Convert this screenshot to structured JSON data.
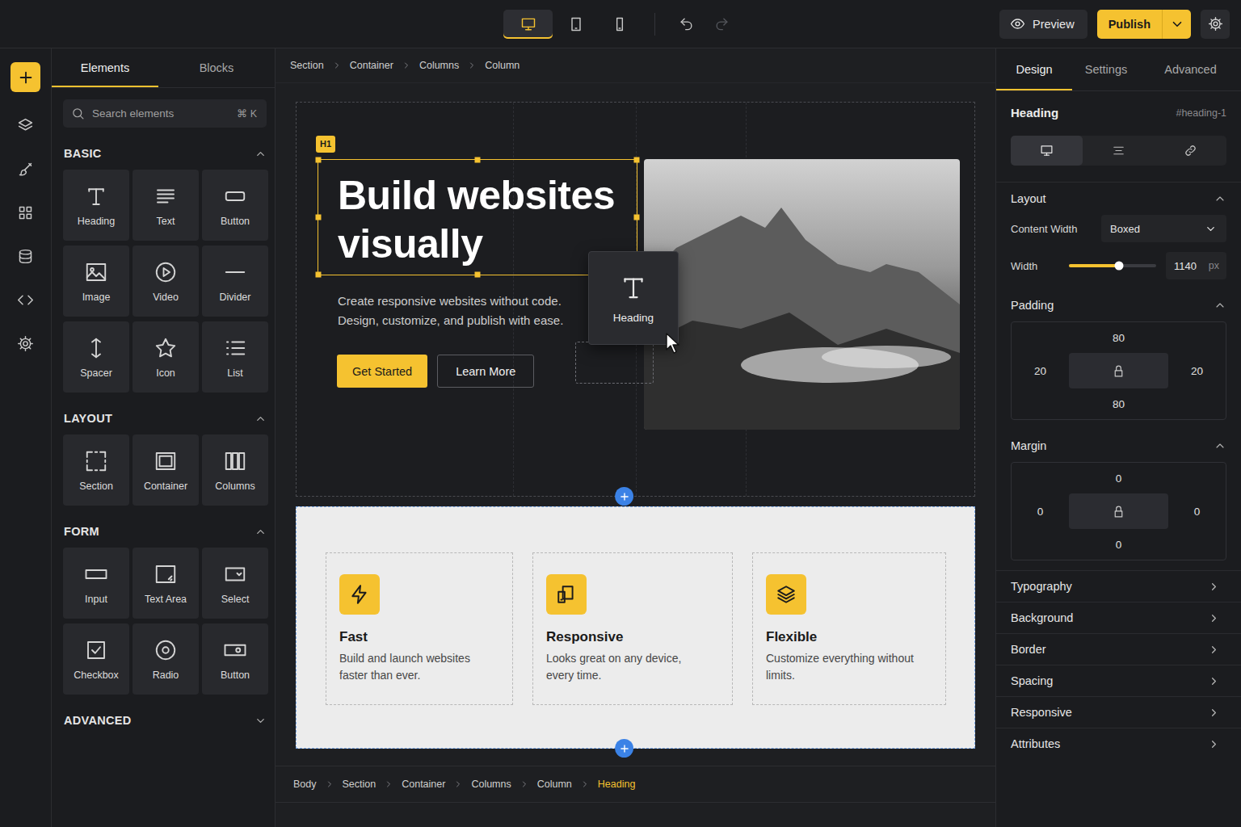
{
  "topbar": {
    "devices": [
      {
        "kind": "desktop",
        "selected": true
      },
      {
        "kind": "tablet",
        "selected": false
      },
      {
        "kind": "mobile",
        "selected": false
      }
    ],
    "history": [
      {
        "kind": "undo",
        "disabled": false
      },
      {
        "kind": "redo",
        "disabled": true
      }
    ],
    "preview": "Preview",
    "publish": "Publish"
  },
  "rail": [
    {
      "kind": "plus",
      "selected": true
    },
    {
      "kind": "layers",
      "selected": false
    },
    {
      "kind": "brush",
      "selected": false
    },
    {
      "kind": "grid",
      "selected": false
    },
    {
      "kind": "database",
      "selected": false
    },
    {
      "kind": "code",
      "selected": false
    },
    {
      "kind": "gear",
      "selected": false
    }
  ],
  "library": {
    "tabs": [
      {
        "label": "Elements",
        "selected": true
      },
      {
        "label": "Blocks",
        "selected": false
      }
    ],
    "search": {
      "placeholder": "Search elements",
      "shortcut": "⌘ K"
    },
    "groups": [
      {
        "title": "BASIC",
        "expanded": true,
        "items": [
          {
            "label": "Heading",
            "kind": "heading"
          },
          {
            "label": "Text",
            "kind": "text"
          },
          {
            "label": "Button",
            "kind": "button"
          },
          {
            "label": "Image",
            "kind": "image"
          },
          {
            "label": "Video",
            "kind": "video"
          },
          {
            "label": "Divider",
            "kind": "divider"
          },
          {
            "label": "Spacer",
            "kind": "spacer"
          },
          {
            "label": "Icon",
            "kind": "star"
          },
          {
            "label": "List",
            "kind": "list"
          }
        ]
      },
      {
        "title": "LAYOUT",
        "expanded": true,
        "items": [
          {
            "label": "Section",
            "kind": "section"
          },
          {
            "label": "Container",
            "kind": "container"
          },
          {
            "label": "Columns",
            "kind": "columns"
          }
        ]
      },
      {
        "title": "FORM",
        "expanded": true,
        "items": [
          {
            "label": "Input",
            "kind": "input"
          },
          {
            "label": "Text Area",
            "kind": "textarea"
          },
          {
            "label": "Select",
            "kind": "select"
          },
          {
            "label": "Checkbox",
            "kind": "checkbox"
          },
          {
            "label": "Radio",
            "kind": "radio"
          },
          {
            "label": "Button",
            "kind": "toggle"
          }
        ]
      },
      {
        "title": "ADVANCED",
        "expanded": false,
        "items": []
      }
    ]
  },
  "canvas": {
    "breadcrumb": [
      "Section",
      "Container",
      "Columns",
      "Column"
    ],
    "hero": {
      "badge": "H1",
      "heading": "Build websites visually",
      "lead": "Create responsive websites without code. Design, customize, and publish with ease.",
      "buttons": [
        {
          "label": "Get Started",
          "kind": "primary"
        },
        {
          "label": "Learn More",
          "kind": "secondary"
        }
      ]
    },
    "drag": {
      "label": "Heading",
      "kind": "heading"
    },
    "features": [
      {
        "title": "Fast",
        "text": "Build and launch websites faster than ever.",
        "kind": "bolt"
      },
      {
        "title": "Responsive",
        "text": "Looks great on any device, every time.",
        "kind": "devices"
      },
      {
        "title": "Flexible",
        "text": "Customize everything without limits.",
        "kind": "stack"
      }
    ]
  },
  "path": [
    {
      "label": "Body",
      "selected": false
    },
    {
      "label": "Section",
      "selected": false
    },
    {
      "label": "Container",
      "selected": false
    },
    {
      "label": "Columns",
      "selected": false
    },
    {
      "label": "Column",
      "selected": false
    },
    {
      "label": "Heading",
      "selected": true
    }
  ],
  "inspector": {
    "tabs": [
      {
        "label": "Design",
        "selected": true
      },
      {
        "label": "Settings",
        "selected": false
      },
      {
        "label": "Advanced",
        "selected": false
      }
    ],
    "element": {
      "title": "Heading",
      "id": "#heading-1"
    },
    "modes": [
      {
        "kind": "desktop",
        "selected": true
      },
      {
        "kind": "align",
        "selected": false
      },
      {
        "kind": "link",
        "selected": false
      }
    ],
    "layout": {
      "title": "Layout",
      "expanded": true,
      "content_width": {
        "label": "Content Width",
        "value": "Boxed"
      },
      "width": {
        "label": "Width",
        "level": 0.57,
        "value": "1140",
        "unit": "px"
      }
    },
    "padding": {
      "title": "Padding",
      "expanded": true,
      "locked": true,
      "top": "80",
      "right": "20",
      "bottom": "80",
      "left": "20"
    },
    "margin": {
      "title": "Margin",
      "expanded": true,
      "locked": true,
      "top": "0",
      "right": "0",
      "bottom": "0",
      "left": "0"
    },
    "groups": [
      "Typography",
      "Background",
      "Border",
      "Spacing",
      "Responsive",
      "Attributes"
    ]
  }
}
